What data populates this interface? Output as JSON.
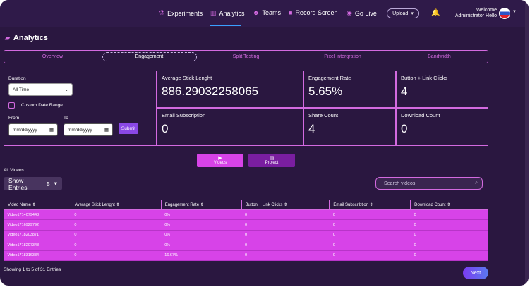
{
  "nav": {
    "items": [
      {
        "label": "Experiments",
        "icon": "flask-icon"
      },
      {
        "label": "Analytics",
        "icon": "bar-chart-icon"
      },
      {
        "label": "Teams",
        "icon": "users-icon"
      },
      {
        "label": "Record Screen",
        "icon": "camera-icon"
      },
      {
        "label": "Go Live",
        "icon": "broadcast-icon"
      }
    ],
    "upload_label": "Upload",
    "welcome_line1": "Welcome",
    "welcome_line2": "Administrator Hello",
    "accent": "#d36ae0"
  },
  "page": {
    "title": "Analytics"
  },
  "tabs": [
    "Overview",
    "Engagement",
    "Split Testing",
    "Pixel Intergration",
    "Bandwidth"
  ],
  "active_tab": "Engagement",
  "filters": {
    "duration_label": "Duration",
    "duration_value": "All Time",
    "custom_range_label": "Custom Date Range",
    "from_label": "From",
    "to_label": "To",
    "from_placeholder": "mm/dd/yyyy",
    "to_placeholder": "mm/dd/yyyy",
    "submit_label": "Submit"
  },
  "stats": {
    "avg_stick": {
      "label": "Average Stick Lenght",
      "value": "886.29032258065"
    },
    "engagement_rate": {
      "label": "Engagement Rate",
      "value": "5.65%"
    },
    "link_clicks": {
      "label": "Button + Link Clicks",
      "value": "4"
    },
    "email_sub": {
      "label": "Email Subscription",
      "value": "0"
    },
    "share_count": {
      "label": "Share Count",
      "value": "4"
    },
    "download_count": {
      "label": "Download Count",
      "value": "0"
    }
  },
  "view_toggle": {
    "videos_label": "Videos",
    "project_label": "Project"
  },
  "list": {
    "all_videos_label": "All Videos",
    "show_entries_label": "Show Entries",
    "show_entries_value": "5",
    "search_placeholder": "Search videos",
    "columns": [
      "Video Name",
      "Average Stick Lenght",
      "Engagement Rate",
      "Button + Link Clicks",
      "Email Subscribtion",
      "Download Count"
    ],
    "rows": [
      [
        "Video1714079448",
        "0",
        "0%",
        "0",
        "0",
        "0"
      ],
      [
        "Video1716929792",
        "0",
        "0%",
        "0",
        "0",
        "0"
      ],
      [
        "Video1718203871",
        "0",
        "0%",
        "0",
        "0",
        "0"
      ],
      [
        "Video1718207348",
        "0",
        "0%",
        "0",
        "0",
        "0"
      ],
      [
        "Video1718316334",
        "0",
        "16.67%",
        "0",
        "0",
        "0"
      ]
    ],
    "showing_text": "Showing 1 to 5 of 31 Entries",
    "next_label": "Next"
  }
}
